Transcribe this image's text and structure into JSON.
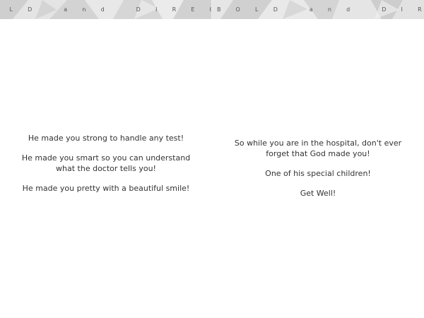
{
  "banner": {
    "left_text": "OLD and DIRECT",
    "right_text": "BOLD and DIREC"
  },
  "left_page": {
    "lines": [
      "He made you strong to handle any test!",
      "He made you smart so you can understand what the doctor tells you!",
      "He made you pretty with a beautiful smile!"
    ]
  },
  "right_page": {
    "lines": [
      "So while you are in the hospital, don't ever forget that God made you!",
      "One of his special children!",
      "Get Well!"
    ]
  }
}
